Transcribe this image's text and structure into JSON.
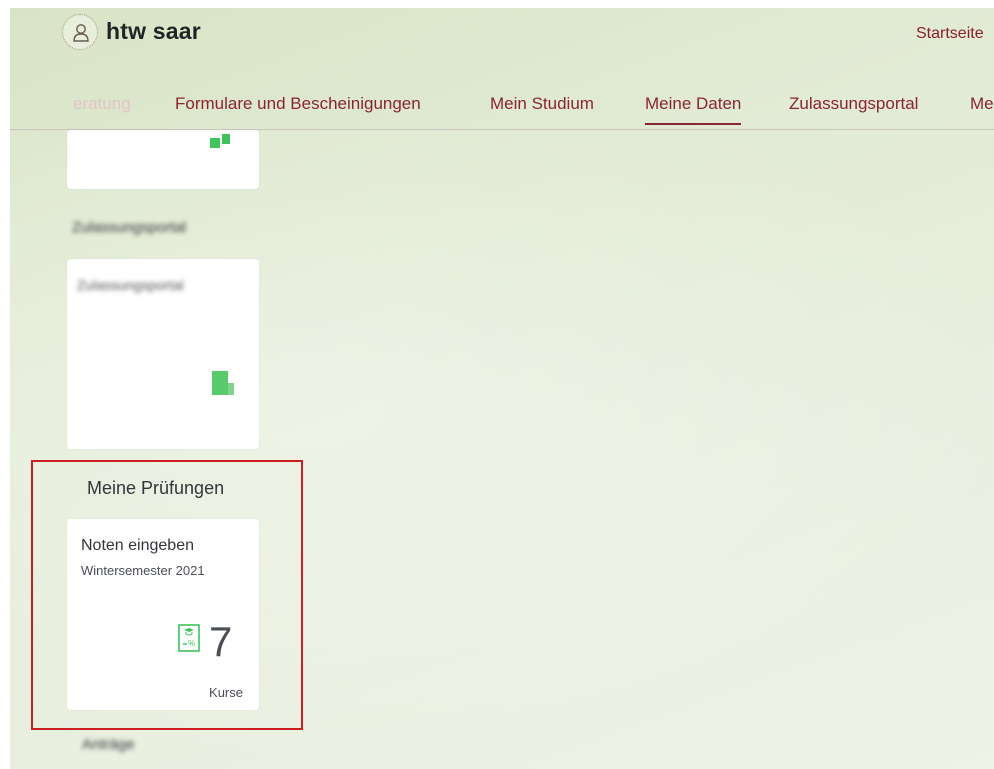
{
  "header": {
    "logo": "htw saar",
    "home_link": "Startseite"
  },
  "nav": {
    "tabs": [
      {
        "label": "eratung",
        "state": "faded"
      },
      {
        "label": "Formulare und Bescheinigungen",
        "state": "normal"
      },
      {
        "label": "Mein Studium",
        "state": "normal"
      },
      {
        "label": "Meine Daten",
        "state": "active"
      },
      {
        "label": "Zulassungsportal",
        "state": "normal"
      },
      {
        "label": "Me",
        "state": "normal"
      }
    ]
  },
  "groups": {
    "zulassung": {
      "title": "Zulassungsportal",
      "tile_title": "Zulassungsportal"
    },
    "pruefungen": {
      "title": "Meine Prüfungen",
      "tile": {
        "title": "Noten eingeben",
        "subtitle": "Wintersemester 2021",
        "icon": "grade-report-icon",
        "value": "7",
        "unit": "Kurse"
      }
    },
    "next": {
      "title": "Anträge"
    }
  },
  "colors": {
    "accent": "#8b2432",
    "tile_icon": "#3ec45a",
    "highlight": "#cc2020"
  }
}
